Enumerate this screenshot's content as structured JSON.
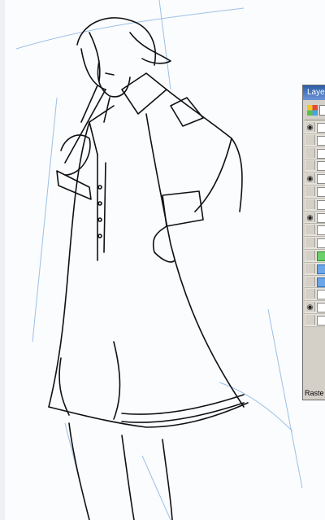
{
  "canvas": {
    "subject": "line-art-character",
    "line_color": "#111111",
    "sketch_color": "#9cc0e6"
  },
  "layers_panel": {
    "title": "Laye",
    "footer_label": "Raste",
    "eye_icon": "eye-icon",
    "rows": [
      {
        "visible": true,
        "thumb": "folder"
      },
      {
        "visible": false,
        "thumb": "raster"
      },
      {
        "visible": false,
        "thumb": "raster"
      },
      {
        "visible": false,
        "thumb": "raster"
      },
      {
        "visible": true,
        "thumb": "raster"
      },
      {
        "visible": false,
        "thumb": "raster"
      },
      {
        "visible": false,
        "thumb": "raster"
      },
      {
        "visible": true,
        "thumb": "raster"
      },
      {
        "visible": false,
        "thumb": "raster"
      },
      {
        "visible": false,
        "thumb": "raster"
      },
      {
        "visible": false,
        "thumb": "raster-green"
      },
      {
        "visible": false,
        "thumb": "raster-blue"
      },
      {
        "visible": false,
        "thumb": "raster-blue"
      },
      {
        "visible": false,
        "thumb": "raster"
      },
      {
        "visible": true,
        "thumb": "raster"
      },
      {
        "visible": false,
        "thumb": "raster"
      }
    ]
  }
}
